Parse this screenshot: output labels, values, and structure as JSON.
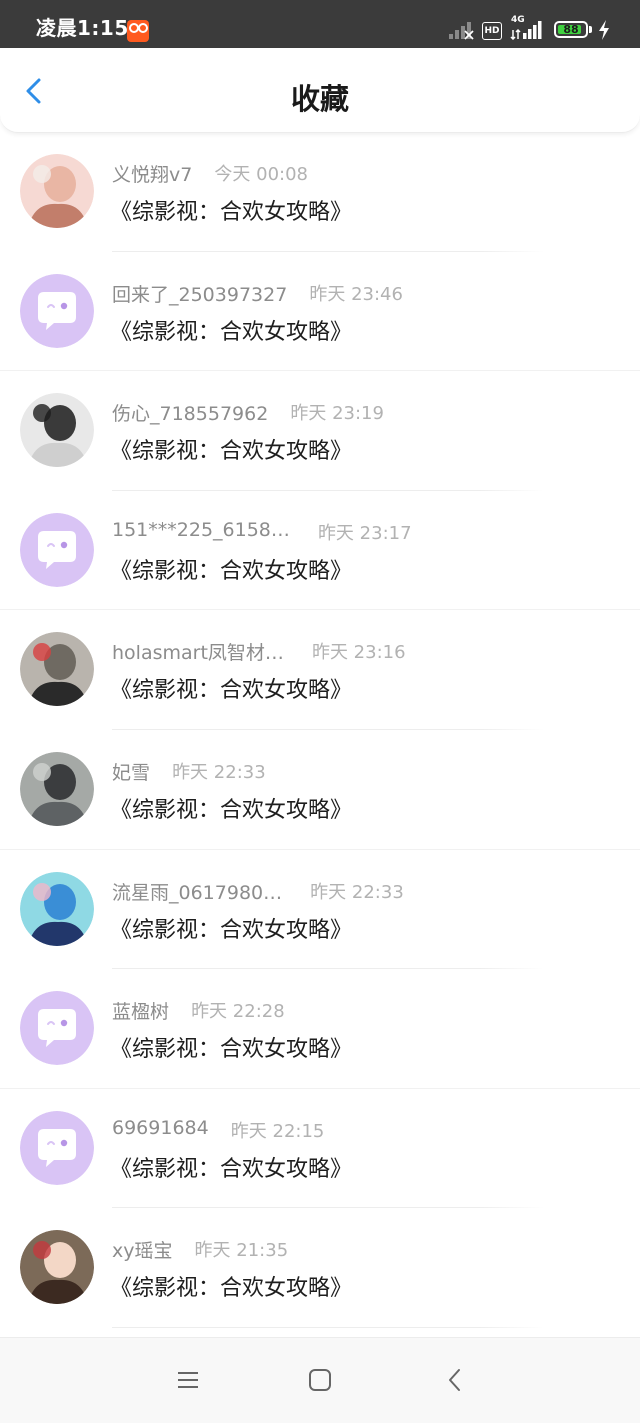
{
  "status_bar": {
    "time": "凌晨1:15",
    "app_icon": "app-notification-icon",
    "hd_label": "HD",
    "network_label": "4G",
    "battery_level": "88",
    "battery_fraction": 0.88,
    "battery_color": "#3fd13f",
    "icons": [
      "weak-signal-icon",
      "hd-icon",
      "4g-signal-icon",
      "battery-icon",
      "charging-icon"
    ]
  },
  "header": {
    "title": "收藏",
    "back_icon": "chevron-left-icon",
    "accent_color": "#2f8ee8"
  },
  "favorites": [
    {
      "user": "义悦翔v7",
      "time": "今天 00:08",
      "book": "《综影视：合欢女攻略》",
      "avatar": "photo-avatar"
    },
    {
      "user": "回来了_250397327",
      "time": "昨天 23:46",
      "book": "《综影视：合欢女攻略》",
      "avatar": "default-avatar"
    },
    {
      "user": "伤心_718557962",
      "time": "昨天 23:19",
      "book": "《综影视：合欢女攻略》",
      "avatar": "photo-avatar"
    },
    {
      "user": "151***225_6158…",
      "time": "昨天 23:17",
      "book": "《综影视：合欢女攻略》",
      "avatar": "default-avatar"
    },
    {
      "user": "holasmart凤智材…",
      "time": "昨天 23:16",
      "book": "《综影视：合欢女攻略》",
      "avatar": "photo-avatar"
    },
    {
      "user": "妃雪",
      "time": "昨天 22:33",
      "book": "《综影视：合欢女攻略》",
      "avatar": "photo-avatar"
    },
    {
      "user": "流星雨_0617980…",
      "time": "昨天 22:33",
      "book": "《综影视：合欢女攻略》",
      "avatar": "photo-avatar"
    },
    {
      "user": "蓝楹树",
      "time": "昨天 22:28",
      "book": "《综影视：合欢女攻略》",
      "avatar": "default-avatar"
    },
    {
      "user": "69691684",
      "time": "昨天 22:15",
      "book": "《综影视：合欢女攻略》",
      "avatar": "default-avatar"
    },
    {
      "user": "xy瑶宝",
      "time": "昨天 21:35",
      "book": "《综影视：合欢女攻略》",
      "avatar": "photo-avatar"
    }
  ],
  "default_avatar_color": "#d9c4f5",
  "nav_bar": {
    "icons": [
      "menu-icon",
      "home-icon",
      "back-icon"
    ]
  }
}
